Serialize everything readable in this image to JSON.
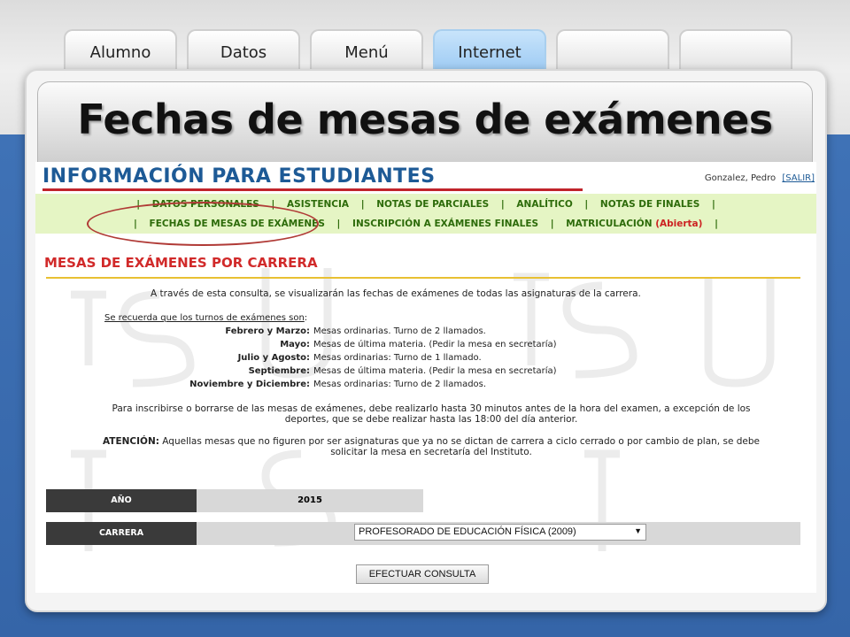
{
  "tabs": [
    {
      "label": "Alumno",
      "active": false
    },
    {
      "label": "Datos",
      "active": false
    },
    {
      "label": "Menú",
      "active": false
    },
    {
      "label": "Internet",
      "active": true
    },
    {
      "label": "",
      "active": false
    },
    {
      "label": "",
      "active": false
    }
  ],
  "slide_title": "Fechas de mesas de exámenes",
  "portal": {
    "title": "INFORMACIÓN PARA ESTUDIANTES",
    "user": "Gonzalez, Pedro",
    "logout": "[SALIR]"
  },
  "nav": {
    "row1": [
      "DATOS PERSONALES",
      "ASISTENCIA",
      "NOTAS DE PARCIALES",
      "ANALÍTICO",
      "NOTAS DE FINALES"
    ],
    "row2": [
      "FECHAS DE MESAS DE EXÁMENES",
      "INSCRIPCIÓN A EXÁMENES FINALES",
      "MATRICULACIÓN"
    ],
    "open_label": "(Abierta)",
    "separator": "|"
  },
  "section": {
    "title": "MESAS DE EXÁMENES POR CARRERA",
    "intro": "A través de esta consulta, se visualizarán las fechas de exámenes de todas las asignaturas de la carrera.",
    "reminder": "Se recuerda que los turnos de exámenes son",
    "reminder_suffix": ":",
    "turns": [
      {
        "label": "Febrero y Marzo:",
        "value": "Mesas ordinarias. Turno de 2 llamados."
      },
      {
        "label": "Mayo:",
        "value": "Mesas de última materia. (Pedir la mesa en secretaría)"
      },
      {
        "label": "Julio y Agosto:",
        "value": "Mesas ordinarias: Turno de 1 llamado."
      },
      {
        "label": "Septiembre:",
        "value": "Mesas de última materia. (Pedir la mesa en secretaría)"
      },
      {
        "label": "Noviembre y Diciembre:",
        "value": "Mesas ordinarias: Turno de 2 llamados."
      }
    ],
    "note_line1": "Para inscribirse o borrarse de las mesas de exámenes, debe realizarlo hasta 30 minutos antes de la hora del examen, a excepción de los",
    "note_line2": "deportes, que se debe realizar hasta las 18:00 del día anterior.",
    "attention_label": "ATENCIÓN:",
    "attention_line1": "Aquellas mesas que no figuren por ser asignaturas que ya no se dictan de carrera a ciclo cerrado o por cambio de plan, se debe",
    "attention_line2": "solicitar la mesa en secretaría del Instituto."
  },
  "form": {
    "year_label": "AÑO",
    "year_value": "2015",
    "career_label": "CARRERA",
    "career_value": "PROFESORADO DE EDUCACIÓN FÍSICA (2009)",
    "submit": "EFECTUAR CONSULTA"
  },
  "colors": {
    "blue_band": "#3f72b6",
    "portal_title": "#1d5a96",
    "accent_red": "#d12a2a",
    "nav_bg": "#e5f5c4",
    "nav_text": "#2d6b0a"
  }
}
